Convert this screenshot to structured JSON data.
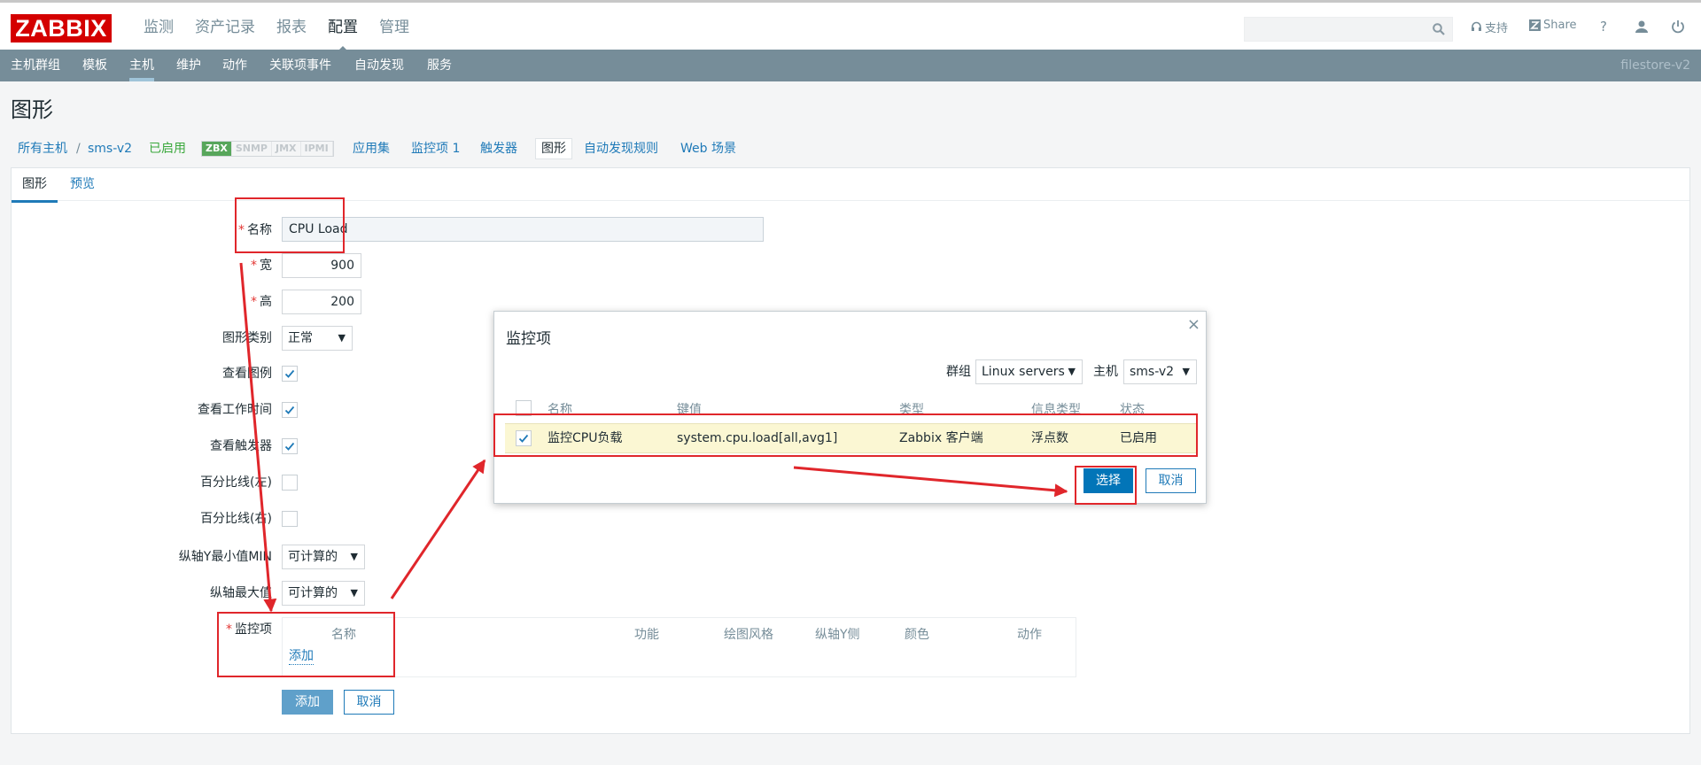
{
  "header": {
    "logo": "ZABBIX",
    "menu": [
      "监测",
      "资产记录",
      "报表",
      "配置",
      "管理"
    ],
    "active_menu_index": 3,
    "search_placeholder": "",
    "support_label": "支持",
    "share_label": "Share",
    "help_label": "?"
  },
  "subnav": {
    "items": [
      "主机群组",
      "模板",
      "主机",
      "维护",
      "动作",
      "关联项事件",
      "自动发现",
      "服务"
    ],
    "active_index": 2,
    "server_name": "filestore-v2"
  },
  "page_title": "图形",
  "breadcrumb": {
    "all_hosts": "所有主机",
    "separator": "/",
    "host": "sms-v2",
    "status": "已启用",
    "tags": [
      "ZBX",
      "SNMP",
      "JMX",
      "IPMI"
    ],
    "links": [
      "应用集",
      "监控项 1",
      "触发器",
      "图形",
      "自动发现规则",
      "Web 场景"
    ],
    "active_link_index": 3
  },
  "tabs": [
    "图形",
    "预览"
  ],
  "form": {
    "name": {
      "label": "名称",
      "value": "CPU Load"
    },
    "width": {
      "label": "宽",
      "value": "900"
    },
    "height": {
      "label": "高",
      "value": "200"
    },
    "graph_type": {
      "label": "图形类别",
      "value": "正常"
    },
    "show_legend": {
      "label": "查看图例",
      "checked": true
    },
    "show_working_time": {
      "label": "查看工作时间",
      "checked": true
    },
    "show_triggers": {
      "label": "查看触发器",
      "checked": true
    },
    "percentile_left": {
      "label": "百分比线(左)",
      "checked": false
    },
    "percentile_right": {
      "label": "百分比线(右)",
      "checked": false
    },
    "ymin": {
      "label": "纵轴Y最小值MIN",
      "value": "可计算的"
    },
    "ymax": {
      "label": "纵轴最大值",
      "value": "可计算的"
    },
    "items": {
      "label": "监控项",
      "columns": [
        "名称",
        "功能",
        "绘图风格",
        "纵轴Y侧",
        "颜色",
        "动作"
      ],
      "add_link": "添加"
    },
    "add_button": "添加",
    "cancel_button": "取消"
  },
  "modal": {
    "title": "监控项",
    "close": "×",
    "group_label": "群组",
    "group_value": "Linux servers",
    "host_label": "主机",
    "host_value": "sms-v2",
    "columns": [
      "名称",
      "键值",
      "类型",
      "信息类型",
      "状态"
    ],
    "rows": [
      {
        "name": "监控CPU负载",
        "key": "system.cpu.load[all,avg1]",
        "type": "Zabbix 客户端",
        "info_type": "浮点数",
        "status": "已启用",
        "checked": true
      }
    ],
    "select_button": "选择",
    "cancel_button": "取消"
  },
  "colors": {
    "brand": "#d40000",
    "nav": "#768d99",
    "link": "#1f7ab8",
    "annotation": "#e0262b",
    "enabled": "#3aa83c",
    "selected_row": "#fbf7d3"
  }
}
